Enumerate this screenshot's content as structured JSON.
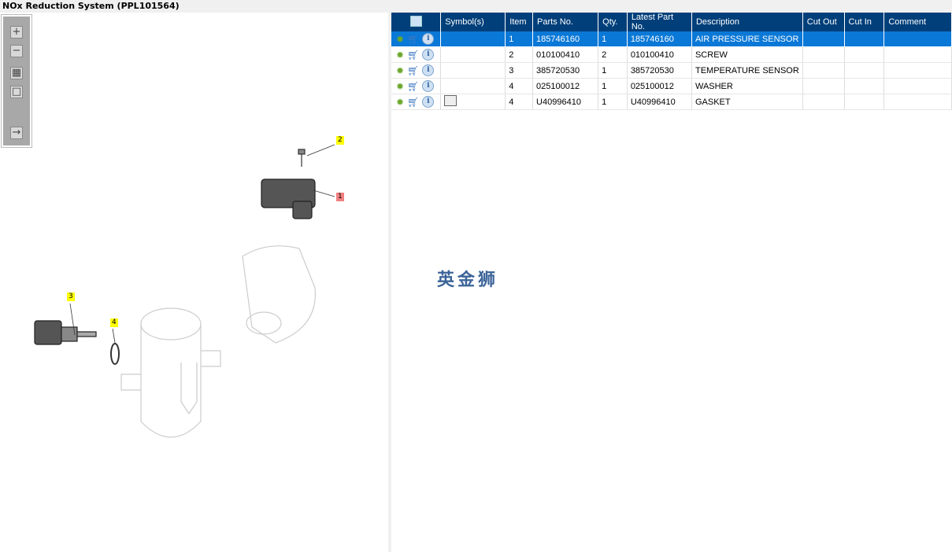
{
  "window": {
    "title": "NOx Reduction System (PPL101564)"
  },
  "toolbar": {
    "buttons": [
      "zoom-in",
      "zoom-out",
      "fit-all",
      "fit-window",
      "export"
    ]
  },
  "diagram": {
    "callouts": [
      {
        "label": "1",
        "color": "#f08080"
      },
      {
        "label": "2",
        "color": "#ffff00"
      },
      {
        "label": "3",
        "color": "#ffff00"
      },
      {
        "label": "4",
        "color": "#ffff00"
      }
    ]
  },
  "table": {
    "headers": [
      "",
      "Symbol(s)",
      "Item",
      "Parts No.",
      "Qty.",
      "Latest Part No.",
      "Description",
      "Cut Out",
      "Cut In",
      "Comment"
    ],
    "rows": [
      {
        "symbol": "",
        "item": "1",
        "part": "185746160",
        "qty": "1",
        "latest": "185746160",
        "desc": "AIR PRESSURE SENSOR",
        "cut_out": "",
        "cut_in": "",
        "comment": "",
        "selected": true
      },
      {
        "symbol": "",
        "item": "2",
        "part": "010100410",
        "qty": "2",
        "latest": "010100410",
        "desc": "SCREW",
        "cut_out": "",
        "cut_in": "",
        "comment": ""
      },
      {
        "symbol": "",
        "item": "3",
        "part": "385720530",
        "qty": "1",
        "latest": "385720530",
        "desc": "TEMPERATURE SENSOR",
        "cut_out": "",
        "cut_in": "",
        "comment": ""
      },
      {
        "symbol": "",
        "item": "4",
        "part": "025100012",
        "qty": "1",
        "latest": "025100012",
        "desc": "WASHER",
        "cut_out": "",
        "cut_in": "",
        "comment": ""
      },
      {
        "symbol": "book-search-icon",
        "item": "4",
        "part": "U40996410",
        "qty": "1",
        "latest": "U40996410",
        "desc": "GASKET",
        "cut_out": "",
        "cut_in": "",
        "comment": ""
      }
    ]
  },
  "watermark": "英金狮"
}
